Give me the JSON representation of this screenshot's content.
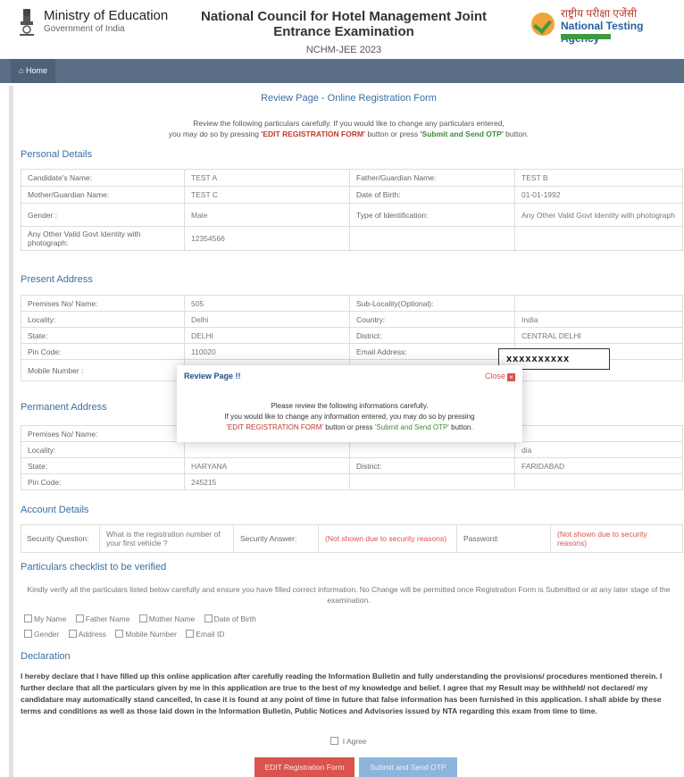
{
  "header": {
    "ministry_title": "Ministry of Education",
    "ministry_sub": "Government of India",
    "council_title": "National Council for Hotel Management Joint Entrance Examination",
    "exam_name": "NCHM-JEE 2023",
    "nta_hindi": "राष्ट्रीय परीक्षा एजेंसी",
    "nta_name": "National Testing Agency"
  },
  "nav": {
    "home_label": "Home",
    "home_icon": "home-icon"
  },
  "page": {
    "title": "Review Page - Online Registration Form",
    "instr_line1": "Review the following particulars carefully. If you would like to change any particulars entered,",
    "instr_pre": "you may do so by pressing ",
    "instr_edit": "'EDIT REGISTRATION FORM'",
    "instr_mid": " button or press ",
    "instr_submit": "'Submit and Send OTP'",
    "instr_post": " button."
  },
  "personal": {
    "heading": "Personal Details",
    "rows": [
      [
        "Candidate's Name:",
        "TEST A",
        "Father/Guardian Name:",
        "TEST B"
      ],
      [
        "Mother/Guardian Name:",
        "TEST C",
        "Date of Birth:",
        "01-01-1992"
      ],
      [
        "Gender :",
        "Male",
        "Type of Identification:",
        "Any Other Valid Govt Identity with photograph"
      ],
      [
        "Any Other Valid Govt Identity with photograph:",
        "12354566",
        "",
        ""
      ]
    ]
  },
  "present": {
    "heading": "Present Address",
    "rows": [
      [
        "Premises No/ Name:",
        "505",
        "Sub-Locality(Optional):",
        ""
      ],
      [
        "Locality:",
        "Delhi",
        "Country:",
        "India"
      ],
      [
        "State:",
        "DELHI",
        "District:",
        "CENTRAL DELHI"
      ],
      [
        "Pin Code:",
        "110020",
        "Email Address:",
        ""
      ],
      [
        "Mobile Number :",
        "",
        "",
        ""
      ]
    ],
    "email_masked": "xxxxxxxxxx"
  },
  "permanent": {
    "heading": "Permanent Address",
    "rows": [
      [
        "Premises No/ Name:",
        "",
        "",
        ""
      ],
      [
        "Locality:",
        "",
        "",
        "dia"
      ],
      [
        "State:",
        "HARYANA",
        "District:",
        "FARIDABAD"
      ],
      [
        "Pin Code:",
        "245215",
        "",
        ""
      ]
    ]
  },
  "account": {
    "heading": "Account Details",
    "sec_q_label": "Security Question:",
    "sec_q_value": "What is the registration number of your first vehicle ?",
    "sec_a_label": "Security Answer:",
    "sec_a_value": "(Not shown due to security reasons)",
    "pwd_label": "Password:",
    "pwd_value": "(Not shown due to security reasons)"
  },
  "checklist": {
    "heading": "Particulars checklist to be verified",
    "text": "Kindly verify all the particulars listed below carefully and ensure you have filled correct information. No Change will be permitted once Registration Form is Submitted or at any later stage of the examination.",
    "items_row1": [
      "My Name",
      "Father Name",
      "Mother Name",
      "Date of Birth"
    ],
    "items_row2": [
      "Gender",
      "Address",
      "Mobile Number",
      "Email ID"
    ]
  },
  "declaration": {
    "heading": "Declaration",
    "text": "I hereby declare that I have filled up this online application after carefully reading the Information Bulletin and fully understanding the provisions/ procedures mentioned therein. I further declare that all the particulars given by me in this application are true to the best of my knowledge and belief. I agree that my Result may be withheld/ not declared/ my candidature may automatically stand cancelled, In case it is found at any point of time in future that false information has been furnished in this application. I shall abide by these terms and conditions as well as those laid down in the Information Bulletin, Public Notices and Advisories issued by NTA regarding this exam from time to time.",
    "agree_label": "I Agree"
  },
  "buttons": {
    "edit_label": "EDIT Registration Form",
    "submit_label": "Submit and Send OTP"
  },
  "modal": {
    "title": "Review Page !!",
    "close_label": "Close",
    "line1": "Please review the following informations carefully.",
    "line2": "If you would like to change any information entered, you may do so by pressing",
    "edit_text": "'EDIT REGISTRATION FORM'",
    "mid_text": " button or press ",
    "submit_text": "'Submit and Send OTP'",
    "end_text": " button."
  }
}
